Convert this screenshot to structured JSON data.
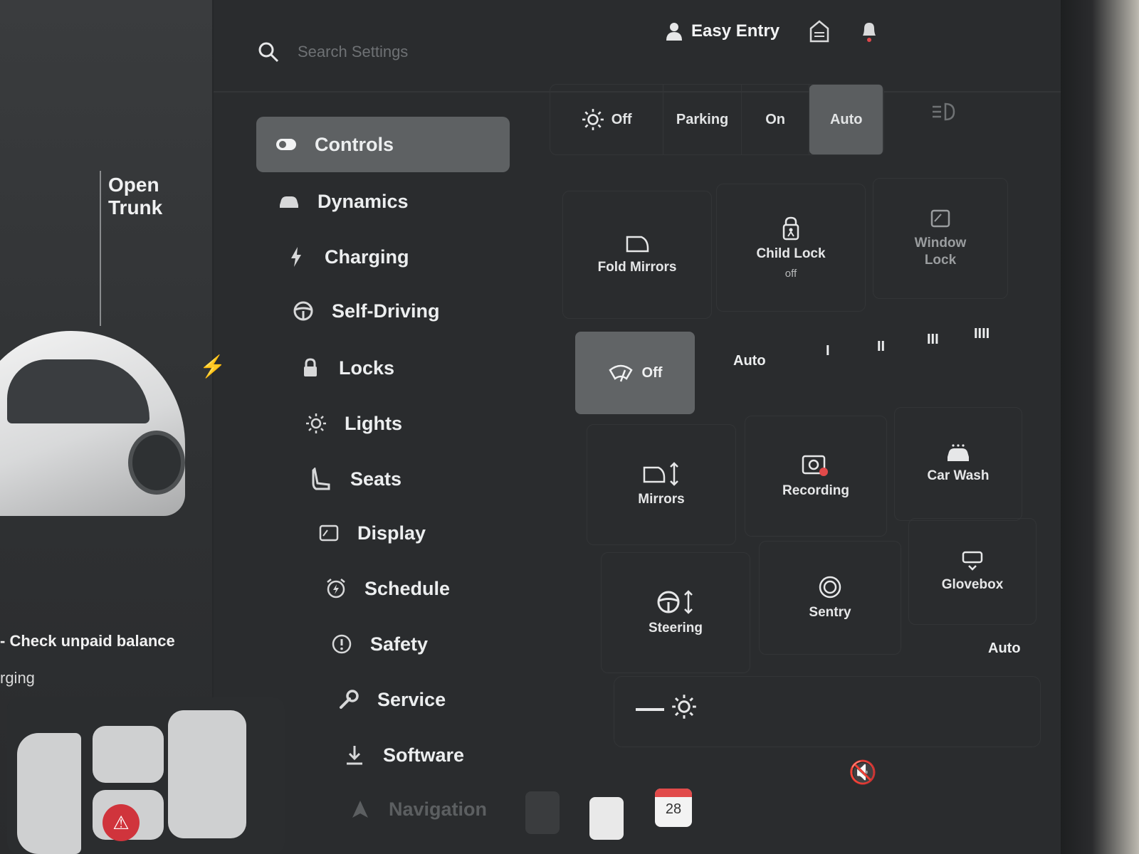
{
  "left_panel": {
    "trunk_label_line1": "Open",
    "trunk_label_line2": "Trunk",
    "balance_notice": "- Check unpaid balance",
    "charging_fragment": "rging"
  },
  "header": {
    "search_placeholder": "Search Settings",
    "profile_name": "Easy Entry"
  },
  "nav": {
    "items": [
      {
        "label": "Controls",
        "icon": "toggle-icon"
      },
      {
        "label": "Dynamics",
        "icon": "car-icon"
      },
      {
        "label": "Charging",
        "icon": "bolt-icon"
      },
      {
        "label": "Self-Driving",
        "icon": "steering-wheel-icon"
      },
      {
        "label": "Locks",
        "icon": "lock-icon"
      },
      {
        "label": "Lights",
        "icon": "light-icon"
      },
      {
        "label": "Seats",
        "icon": "seat-icon"
      },
      {
        "label": "Display",
        "icon": "display-icon"
      },
      {
        "label": "Schedule",
        "icon": "alarm-clock-icon"
      },
      {
        "label": "Safety",
        "icon": "alert-icon"
      },
      {
        "label": "Service",
        "icon": "wrench-icon"
      },
      {
        "label": "Software",
        "icon": "download-icon"
      },
      {
        "label": "Navigation",
        "icon": "navigation-icon"
      }
    ],
    "active_index": 0
  },
  "headlights": {
    "options": [
      "Off",
      "Parking",
      "On",
      "Auto"
    ],
    "selected": "Auto"
  },
  "controls": {
    "fold_mirrors": "Fold Mirrors",
    "child_lock": "Child Lock",
    "child_lock_state": "off",
    "window_lock_line1": "Window",
    "window_lock_line2": "Lock",
    "mirrors": "Mirrors",
    "recording": "Recording",
    "car_wash": "Car Wash",
    "steering": "Steering",
    "sentry": "Sentry",
    "glovebox": "Glovebox"
  },
  "wipers": {
    "off": "Off",
    "auto": "Auto",
    "speeds": [
      "I",
      "II",
      "III",
      "IIII"
    ],
    "selected": "Off"
  },
  "display_brightness": {
    "auto_label": "Auto"
  },
  "dock": {
    "calendar_day": "28"
  }
}
